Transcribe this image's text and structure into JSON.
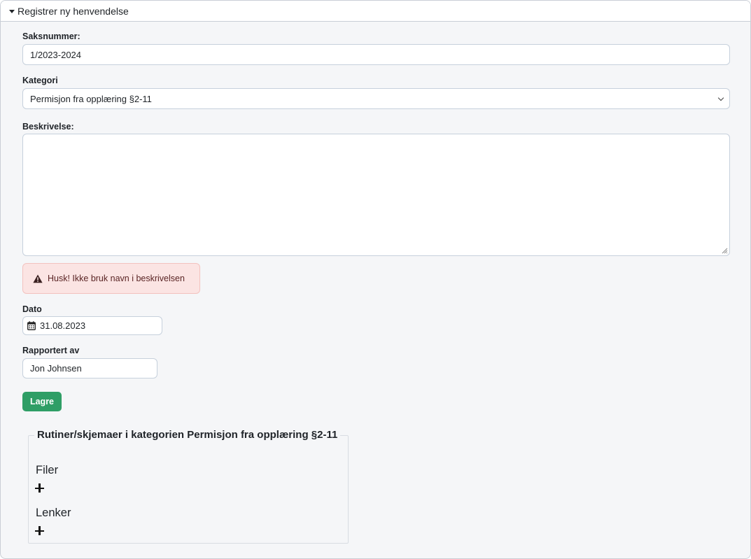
{
  "panel": {
    "title": "Registrer ny henvendelse"
  },
  "form": {
    "case_number": {
      "label": "Saksnummer:",
      "value": "1/2023-2024"
    },
    "category": {
      "label": "Kategori",
      "selected": "Permisjon fra opplæring §2-11"
    },
    "description": {
      "label": "Beskrivelse:",
      "value": ""
    },
    "warning": "Husk! Ikke bruk navn i beskrivelsen",
    "date": {
      "label": "Dato",
      "value": "31.08.2023"
    },
    "reported_by": {
      "label": "Rapportert av",
      "value": "Jon Johnsen"
    },
    "save_label": "Lagre"
  },
  "routines": {
    "legend": "Rutiner/skjemaer i kategorien Permisjon fra opplæring §2-11",
    "files_heading": "Filer",
    "links_heading": "Lenker"
  },
  "icons": {
    "panel_toggle": "caret-down-icon",
    "warning": "warning-triangle-icon",
    "date": "calendar-icon",
    "add_file": "plus-icon",
    "add_link": "plus-icon"
  },
  "colors": {
    "save_button": "#2f9e66",
    "alert_background": "#fbe4e3",
    "panel_background": "#f5f6f8"
  }
}
